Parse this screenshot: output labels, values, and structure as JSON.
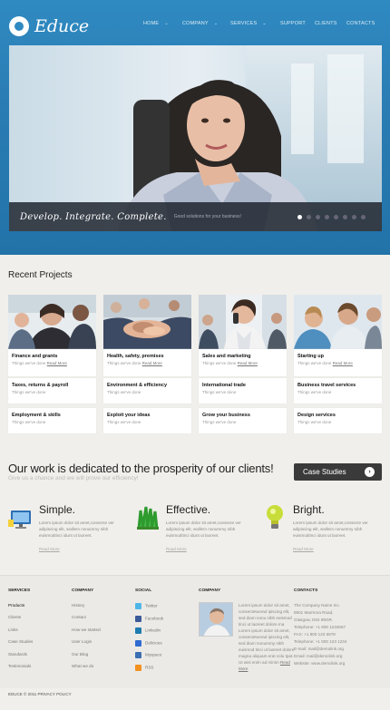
{
  "brand": {
    "name": "Educe"
  },
  "nav": [
    {
      "label": "HOME",
      "has_menu": true
    },
    {
      "label": "COMPANY",
      "has_menu": true
    },
    {
      "label": "SERVICES",
      "has_menu": true
    },
    {
      "label": "SUPPORT",
      "has_menu": false
    },
    {
      "label": "CLIENTS",
      "has_menu": false
    },
    {
      "label": "CONTACTS",
      "has_menu": false
    }
  ],
  "slider": {
    "title": "Develop. Integrate. Complete.",
    "subtitle": "Good solutions for your business!",
    "slide_count": 8,
    "active_slide": 1
  },
  "projects": {
    "heading": "Recent Projects",
    "read_more": "Read More",
    "sub": "Things we've done",
    "columns": [
      {
        "items": [
          "Finance and grants",
          "Taxes, returns & payroll",
          "Employment & skills"
        ]
      },
      {
        "items": [
          "Health, safety, premises",
          "Environment & efficiency",
          "Exploit your ideas"
        ]
      },
      {
        "items": [
          "Sales and marketing",
          "International trade",
          "Grow your business"
        ]
      },
      {
        "items": [
          "Starting up",
          "Business travel services",
          "Design services"
        ]
      }
    ]
  },
  "promo": {
    "tagline": "Our work is dedicated to the prosperity of our clients!",
    "sub": "Give us a chance and we will prove our efficiency!",
    "button": "Case Studies"
  },
  "features": [
    {
      "title": "Simple.",
      "icon": "monitor-icon",
      "text": "Lorem ipsum dolor sit amet,consecte ver adipiscing elit, sedlem nonummy nibh euismodtinci idunt ut laoreet.",
      "link": "Read More"
    },
    {
      "title": "Effective.",
      "icon": "grass-icon",
      "text": "Lorem ipsum dolor sit amet,consecte ver adipiscing elit, sedlem nonummy nibh euismodtinci idunt ut laoreet.",
      "link": "Read More"
    },
    {
      "title": "Bright.",
      "icon": "bulb-icon",
      "text": "Lorem ipsum dolor sit amet,consecte ver adipiscing elit, sedlem nonummy nibh euismodtinci idunt ut laoreet.",
      "link": "Read More"
    }
  ],
  "footer": {
    "services": {
      "heading": "SERVICES",
      "items": [
        "Products",
        "Clients",
        "Links",
        "Case Studies",
        "Standards",
        "Testimonials"
      ]
    },
    "company": {
      "heading": "COMPANY",
      "items": [
        "History",
        "Contact",
        "How we started",
        "User Login",
        "Our Blog",
        "What we do"
      ]
    },
    "social": {
      "heading": "SOCIAL",
      "items": [
        {
          "label": "Twitter",
          "icon": "twitter-icon",
          "color": "#4fb7e8"
        },
        {
          "label": "Facebook",
          "icon": "facebook-icon",
          "color": "#3b5a99"
        },
        {
          "label": "Linkedin",
          "icon": "linkedin-icon",
          "color": "#1f7bb0"
        },
        {
          "label": "Delicious",
          "icon": "delicious-icon",
          "color": "#2f6bd0"
        },
        {
          "label": "Myspace",
          "icon": "myspace-icon",
          "color": "#3a6fb2"
        },
        {
          "label": "RSS",
          "icon": "rss-icon",
          "color": "#f29020"
        }
      ]
    },
    "company_about": {
      "heading": "COMPANY",
      "text": "Lorem ipsum dolor sit amet, consectetuerad ipiscing elit, sed diam nonu nibh euismod tinci ut laoreet dolore ma Lorem ipsum dolor sit amet, consectetuerad ipiscing elit, sed diam nonummy nibh euismod tinci ut laoreet dolore magna aliquam erat volu tpat. Ut wisi enim ad minim",
      "link": "Read More"
    },
    "contacts": {
      "heading": "CONTACTS",
      "lines": [
        "The Company Name Inc.",
        "8901 Marmora Road,",
        "Glasgow, D04 89GR.",
        "Telephone: +1 800 1234567",
        "FAX: +1 800 123 5978",
        "Telephone: +1 800 123 1234",
        "E-mail: mail@demolink.org",
        "Email: mail@demolink.org",
        "Website: www.demolink.org"
      ]
    }
  },
  "copyright": "EDUCE © 2011 PRIVACY POLICY"
}
